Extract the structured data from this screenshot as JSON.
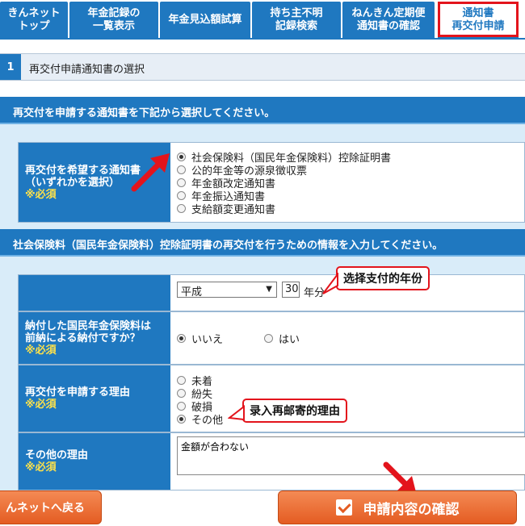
{
  "nav": {
    "tabs": [
      {
        "label": "きんネット\nトップ"
      },
      {
        "label": "年金記録の\n一覧表示"
      },
      {
        "label": "年金見込額試算"
      },
      {
        "label": "持ち主不明\n記録検索"
      },
      {
        "label": "ねんきん定期便\n通知書の確認"
      },
      {
        "label": "通知書\n再交付申請"
      }
    ],
    "active_index": 5
  },
  "step": {
    "number": "1",
    "title": "再交付申請通知書の選択"
  },
  "section1": {
    "instruction": "再交付を申請する通知書を下記から選択してください。",
    "field_label_1": "再交付を希望する通知書",
    "field_label_2": "（いずれかを選択）",
    "required": "※必須",
    "options": [
      {
        "label": "社会保険料（国民年金保険料）控除証明書",
        "selected": true
      },
      {
        "label": "公的年金等の源泉徴収票",
        "selected": false
      },
      {
        "label": "年金額改定通知書",
        "selected": false
      },
      {
        "label": "年金振込通知書",
        "selected": false
      },
      {
        "label": "支給額変更通知書",
        "selected": false
      }
    ]
  },
  "section2": {
    "instruction": "社会保険料（国民年金保険料）控除証明書の再交付を行うための情報を入力してください。",
    "era_value": "平成",
    "year_value": "30",
    "year_unit": "年分",
    "prepay_label_1": "納付した国民年金保険料は",
    "prepay_label_2": "前納による納付ですか？",
    "required": "※必須",
    "prepay_options": [
      {
        "label": "いいえ",
        "selected": true
      },
      {
        "label": "はい",
        "selected": false
      }
    ],
    "reason_label": "再交付を申請する理由",
    "reason_options": [
      {
        "label": "未着",
        "selected": false
      },
      {
        "label": "紛失",
        "selected": false
      },
      {
        "label": "破損",
        "selected": false
      },
      {
        "label": "その他",
        "selected": true
      }
    ],
    "other_reason_label": "その他の理由",
    "other_reason_value": "金額が合わない"
  },
  "callouts": {
    "year": "选择支付的年份",
    "reason": "录入再邮寄的理由"
  },
  "buttons": {
    "back": "んネットへ戻る",
    "confirm": "申請内容の確認"
  },
  "colors": {
    "primary": "#1f78c0",
    "highlight": "#e3141c",
    "button": "#e45c22",
    "required": "#ffe24a"
  }
}
